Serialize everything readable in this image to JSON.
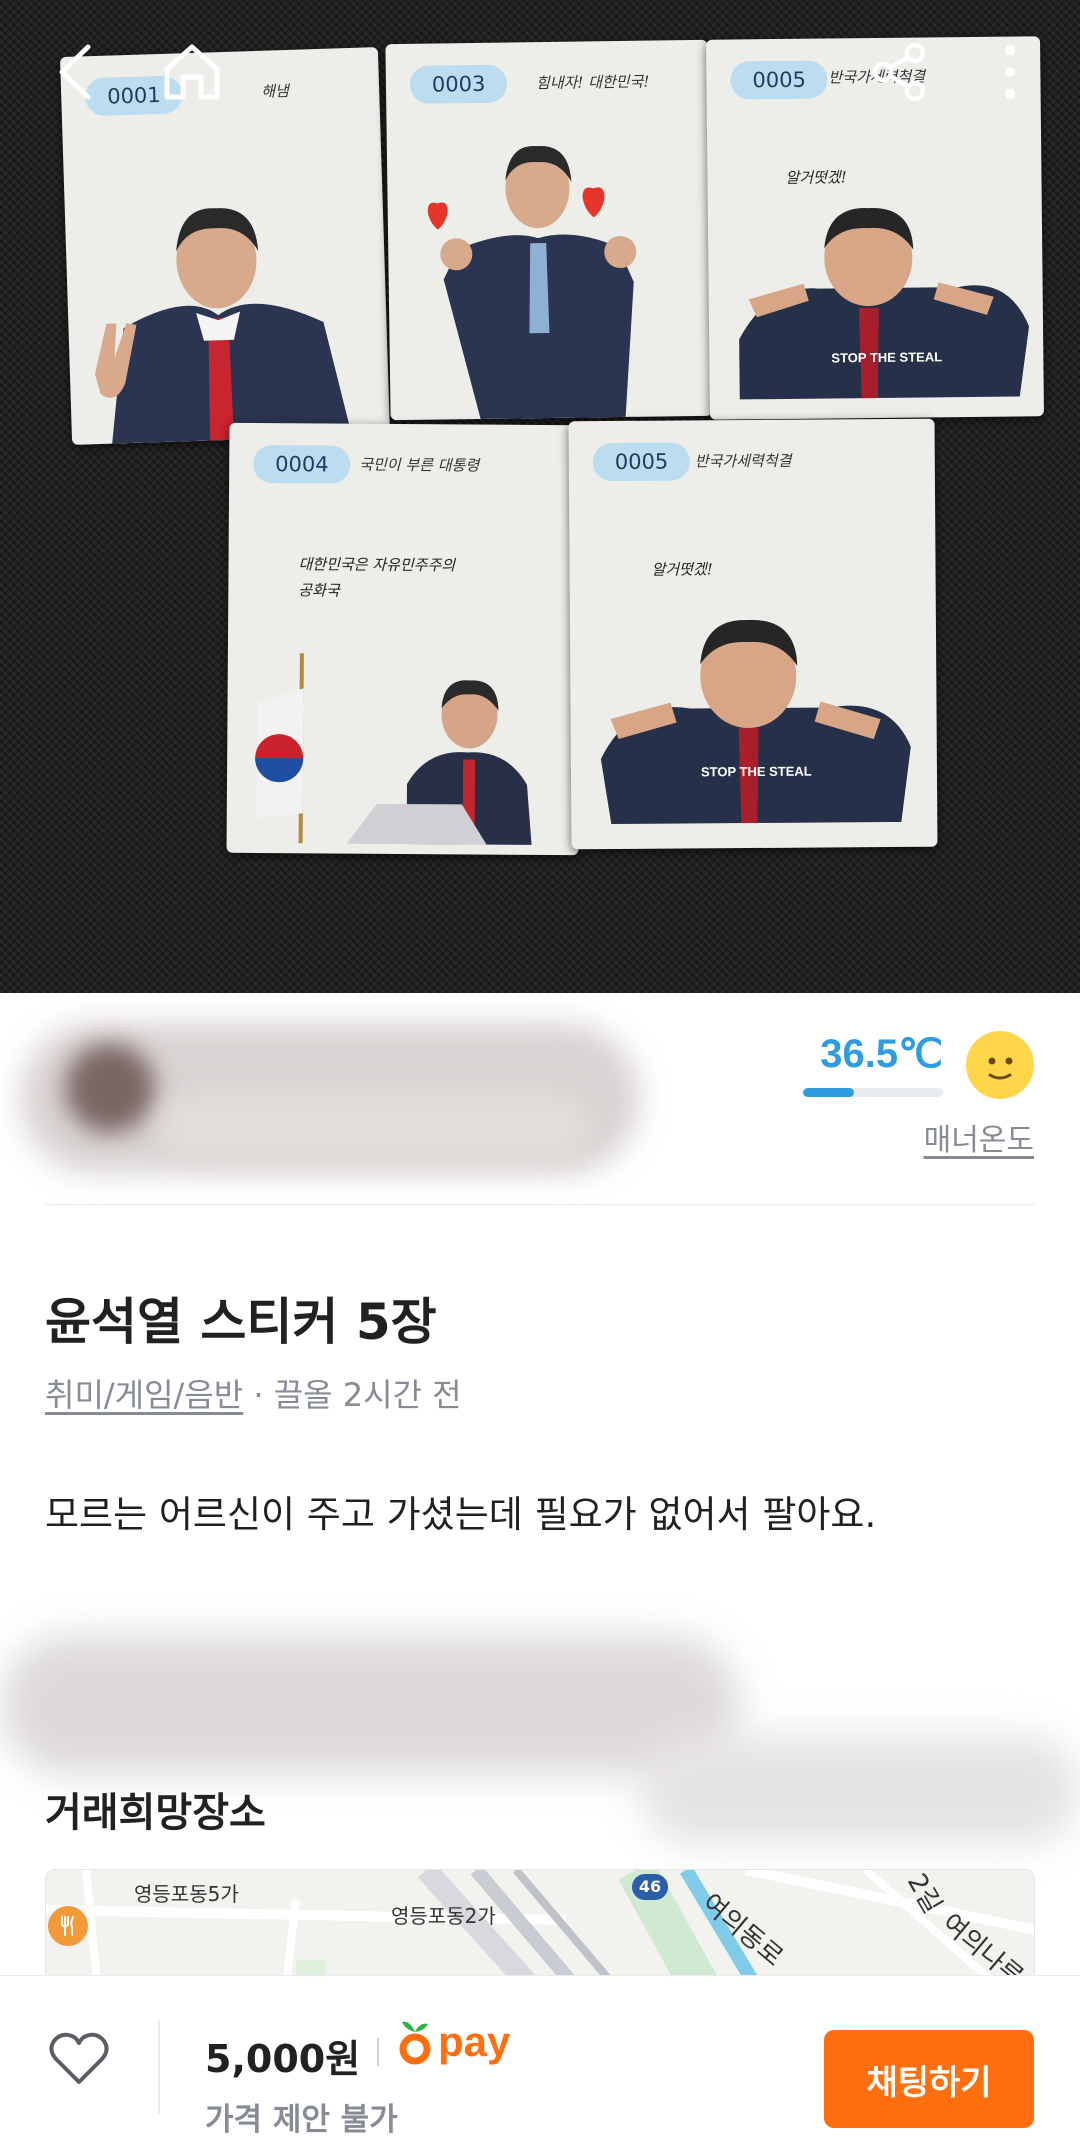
{
  "nav": {
    "back_icon": "chevron-left-icon",
    "home_icon": "home-icon",
    "share_icon": "share-icon",
    "more_icon": "more-vertical-icon"
  },
  "photo": {
    "stickers": [
      {
        "code": "0001",
        "caption": "해냄"
      },
      {
        "code": "0003",
        "caption": "힘내자! 대한민국!"
      },
      {
        "code": "0005",
        "caption": "반국가세력척결",
        "quote": "알거떳겠!",
        "tag": "STOP THE STEAL"
      },
      {
        "code": "0004",
        "caption": "국민이 부른 대통령",
        "quote": "대한민국은 자유민주주의 공화국"
      },
      {
        "code": "0005",
        "caption": "반국가세력척결",
        "quote": "알거떳겠!",
        "tag": "STOP THE STEAL"
      }
    ]
  },
  "seller": {
    "temperature": "36.5℃",
    "temperature_level": 0.365,
    "manner_label": "매너온도",
    "face_icon": "smile-face-icon"
  },
  "product": {
    "title": "윤석열 스티커 5장",
    "category": "취미/게임/음반",
    "time": " · 끌올 2시간 전",
    "description": "모르는 어르신이 주고 가셨는데 필요가 없어서 팔아요."
  },
  "place": {
    "heading": "거래희망장소",
    "map_labels": {
      "area1": "영등포동5가",
      "area2": "영등포동2가",
      "route": "46",
      "road1": "여의동로",
      "road2": "2길",
      "road3": "여의나루"
    }
  },
  "bottom": {
    "heart_icon": "heart-icon",
    "price": "5,000원",
    "pay_label": "pay",
    "negotiation": "가격 제안 불가",
    "chat_button": "채팅하기"
  },
  "colors": {
    "brand_orange": "#ff6f0f",
    "temperature_blue": "#2e9de0",
    "muted_text": "#868b94"
  }
}
